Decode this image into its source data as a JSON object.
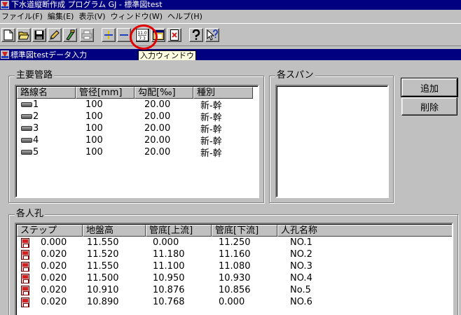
{
  "window": {
    "title": "下水道縦断作成 プログラム GJ - 標準図test"
  },
  "menu": [
    {
      "label": "ファイル(F)"
    },
    {
      "label": "編集(E)"
    },
    {
      "label": "表示(V)"
    },
    {
      "label": "ウィンドウ(W)"
    },
    {
      "label": "ヘルプ(H)"
    }
  ],
  "toolbar": {
    "input_window_icon_top": "11.0",
    "input_window_icon_bottom": "7.3",
    "tooltip": "入力ウィンドウ",
    "highlight_color": "#e00000"
  },
  "child_window": {
    "title": "標準図testデータ入力"
  },
  "main_pipes": {
    "title": "主要管路",
    "columns": [
      "路線名",
      "管径[mm]",
      "勾配[‰]",
      "種別"
    ],
    "rows": [
      [
        "1",
        "100",
        "20.00",
        "新-幹"
      ],
      [
        "2",
        "100",
        "20.00",
        "新-幹"
      ],
      [
        "3",
        "100",
        "20.00",
        "新-幹"
      ],
      [
        "4",
        "100",
        "20.00",
        "新-幹"
      ],
      [
        "5",
        "100",
        "20.00",
        "新-幹"
      ]
    ]
  },
  "spans": {
    "title": "各スパン"
  },
  "buttons": {
    "add": "追加",
    "delete": "削除"
  },
  "manholes": {
    "title": "各人孔",
    "columns": [
      "ステップ",
      "地盤高",
      "管底[上流]",
      "管底[下流]",
      "人孔名称"
    ],
    "rows": [
      [
        "0.000",
        "11.550",
        "0.000",
        "11.250",
        "NO.1"
      ],
      [
        "0.020",
        "11.520",
        "11.180",
        "11.160",
        "NO.2"
      ],
      [
        "0.020",
        "11.550",
        "11.100",
        "11.080",
        "NO.3"
      ],
      [
        "0.020",
        "11.500",
        "10.950",
        "10.930",
        "NO.4"
      ],
      [
        "0.020",
        "10.910",
        "10.876",
        "10.856",
        "No.5"
      ],
      [
        "0.020",
        "10.890",
        "10.768",
        "0.000",
        "NO.6"
      ]
    ]
  }
}
